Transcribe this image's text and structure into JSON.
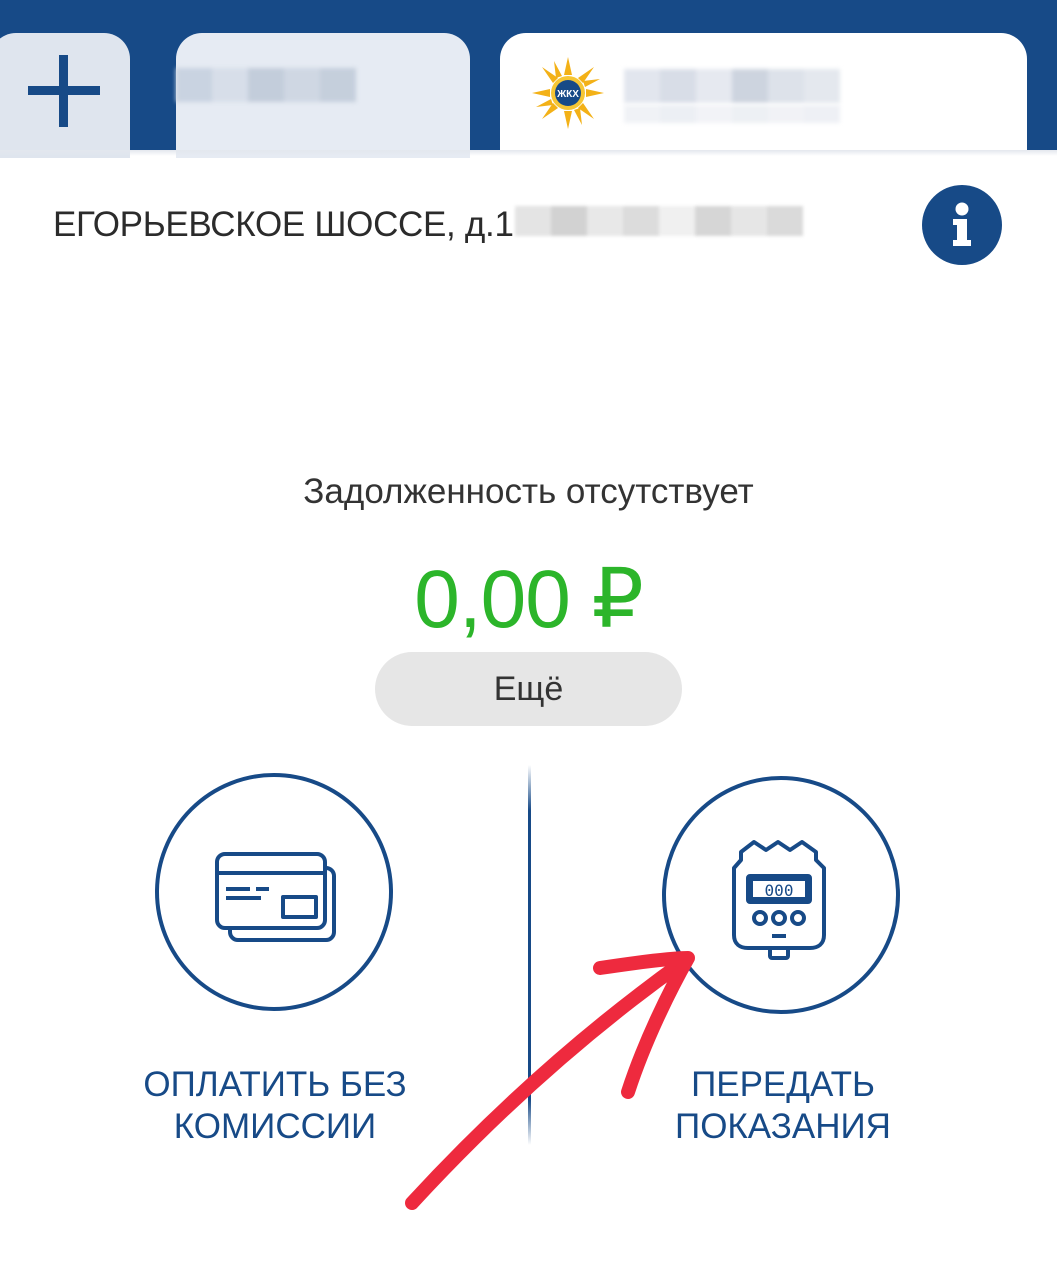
{
  "tabs": {
    "add_icon": "plus-icon",
    "tab2": {},
    "active": {
      "logo_text": "ЖКХ"
    }
  },
  "account": {
    "address": "ЕГОРЬЕВСКОЕ ШОССЕ, д.1",
    "info_icon": "info-icon"
  },
  "balance": {
    "status_text": "Задолженность отсутствует",
    "amount": "0,00 ₽",
    "more_label": "Ещё"
  },
  "actions": {
    "pay": {
      "line1": "ОПЛАТИТЬ БЕЗ",
      "line2": "КОМИССИИ",
      "icon": "credit-card-icon"
    },
    "meter": {
      "line1": "ПЕРЕДАТЬ",
      "line2": "ПОКАЗАНИЯ",
      "icon": "meter-icon",
      "display_digits": "000"
    }
  },
  "colors": {
    "brand": "#174a87",
    "amount_green": "#2cb52a",
    "annotation_arrow": "#ee2a3e"
  }
}
